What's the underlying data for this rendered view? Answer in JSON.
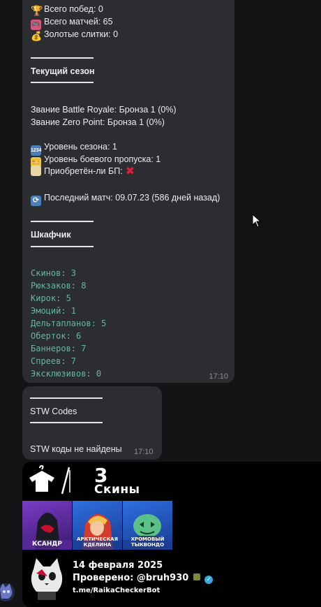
{
  "stats": {
    "wins": "Всего побед: 0",
    "matches": "Всего матчей: 65",
    "gold": "Золотые слитки: 0"
  },
  "season": {
    "heading": "Текущий сезон",
    "br_rank": "Звание Battle Royale: Бронза 1 (0%)",
    "zp_rank": "Звание Zero Point: Бронза 1 (0%)",
    "season_level": "Уровень сезона: 1",
    "bp_level": "Уровень боевого пропуска: 1",
    "bp_bought": "Приобретён-ли БП:",
    "last_match": "Последний матч: 09.07.23 (586 дней назад)"
  },
  "locker": {
    "heading": "Шкафчик",
    "items": [
      "Скинов: 3",
      "Рюкзаков: 8",
      "Кирок: 5",
      "Эмоций: 1",
      "Дельтапланов: 5",
      "Оберток: 6",
      "Баннеров: 7",
      "Спреев: 7",
      "Эксклюзивов: 0"
    ],
    "time": "17:10"
  },
  "stw": {
    "heading": "STW Codes",
    "body": "STW коды не найдены",
    "time": "17:10"
  },
  "card": {
    "count": "3",
    "label": "Скины",
    "skins": [
      "КСАНДР",
      "АРКТИЧЕСКАЯ КДЕЛИНА",
      "ХРОМОВЫЙ ТЫКВОНДО"
    ],
    "date": "14 февраля 2025",
    "checked": "Проверено: @bruh930",
    "link": "t.me/RaikaCheckerBot"
  },
  "colors": {
    "bubble": "#2b2d31",
    "background": "#131416",
    "mono_text": "#6bb3a2"
  }
}
